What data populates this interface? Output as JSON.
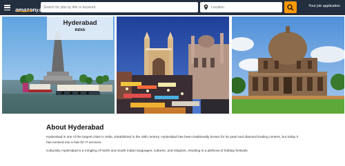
{
  "header": {
    "logo_main": "amazon",
    "logo_sub": "jobs",
    "search_placeholder": "Search for jobs by title or keyword",
    "location_placeholder": "Location",
    "your_application": "Your job application"
  },
  "hero": {
    "city": "Hyderabad",
    "country": "INDIA"
  },
  "about": {
    "title": "About Hyderabad",
    "paragraph1": "Hyderabad is one of the largest cities in India. Established in the 16th century, Hyderabad has been traditionally known for its pearl and diamond trading centers, but today it has evolved into a hub for IT services.",
    "paragraph2": "Culturally, Hyderabad is a mingling of North and South Indian languages, cultures, and religions, resulting in a plethora of holiday festivals."
  },
  "colors": {
    "header_bg": "#232f3e",
    "search_button": "#ff9900",
    "text": "#111111"
  }
}
